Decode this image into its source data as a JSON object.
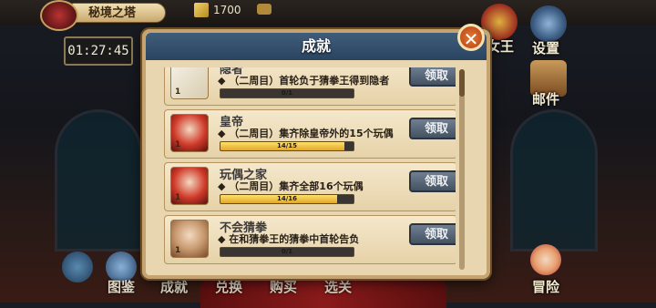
{
  "header": {
    "location": "秘境之塔",
    "coins": "1700",
    "timer": "01:27:45"
  },
  "right_menu": [
    {
      "label": "女王",
      "icon": "queen-icon"
    },
    {
      "label": "设置",
      "icon": "gear-icon"
    },
    {
      "label": "邮件",
      "icon": "mailbox-icon"
    }
  ],
  "bottom_nav": [
    {
      "label": "图鉴",
      "icon": "book-icon"
    },
    {
      "label": "成就",
      "icon": "trophy-icon"
    },
    {
      "label": "兑换",
      "icon": "exchange-icon"
    },
    {
      "label": "购买",
      "icon": "shop-icon"
    },
    {
      "label": "选关",
      "icon": "stage-select-icon"
    }
  ],
  "adventure": {
    "label": "冒险",
    "icon": "adventure-icon"
  },
  "dialog": {
    "title": "成就",
    "close_label": "✕",
    "items": [
      {
        "name": "隐者",
        "desc": "◆ （二周目）首轮负于猜拳王得到隐者",
        "progress_text": "0/1",
        "progress": 0,
        "count": "1",
        "claim_label": "领取"
      },
      {
        "name": "皇帝",
        "desc": "◆ （二周目）集齐除皇帝外的15个玩偶",
        "progress_text": "14/15",
        "progress": 0.933,
        "count": "1",
        "claim_label": "领取"
      },
      {
        "name": "玩偶之家",
        "desc": "◆ （二周目）集齐全部16个玩偶",
        "progress_text": "14/16",
        "progress": 0.875,
        "count": "1",
        "claim_label": "领取"
      },
      {
        "name": "不会猜拳",
        "desc": "◆ 在和猜拳王的猜拳中首轮告负",
        "progress_text": "0/1",
        "progress": 0,
        "count": "1",
        "claim_label": "领取"
      }
    ]
  },
  "colors": {
    "dialog_bg": "#e8d6b0",
    "header_bg": "#2a4460",
    "progress_fill": "#e0a82a",
    "close_button": "#c4511e"
  }
}
